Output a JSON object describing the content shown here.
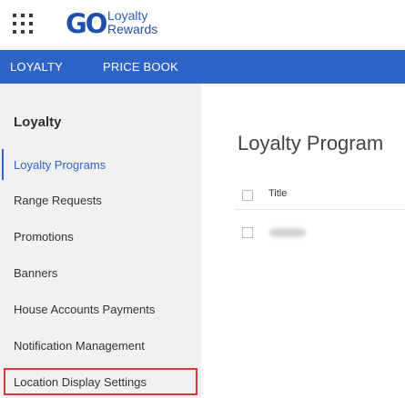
{
  "header": {
    "logo_mark": "GO",
    "logo_line1": "Loyalty",
    "logo_line2": "Rewards"
  },
  "nav": {
    "items": [
      {
        "label": "LOYALTY"
      },
      {
        "label": "PRICE BOOK"
      }
    ]
  },
  "sidebar": {
    "title": "Loyalty",
    "items": [
      {
        "label": "Loyalty Programs",
        "active": true
      },
      {
        "label": "Range Requests"
      },
      {
        "label": "Promotions"
      },
      {
        "label": "Banners"
      },
      {
        "label": "House Accounts Payments"
      },
      {
        "label": "Notification Management"
      },
      {
        "label": "Location Display Settings",
        "highlighted": true
      }
    ]
  },
  "main": {
    "title": "Loyalty Program",
    "table": {
      "columns": [
        "Title"
      ]
    }
  },
  "colors": {
    "brand_blue": "#2f63c7",
    "highlight_red": "#d9363e",
    "sidebar_bg": "#f1f1f1"
  },
  "icons": [
    "apps-grid-icon",
    "checkbox-icon"
  ]
}
